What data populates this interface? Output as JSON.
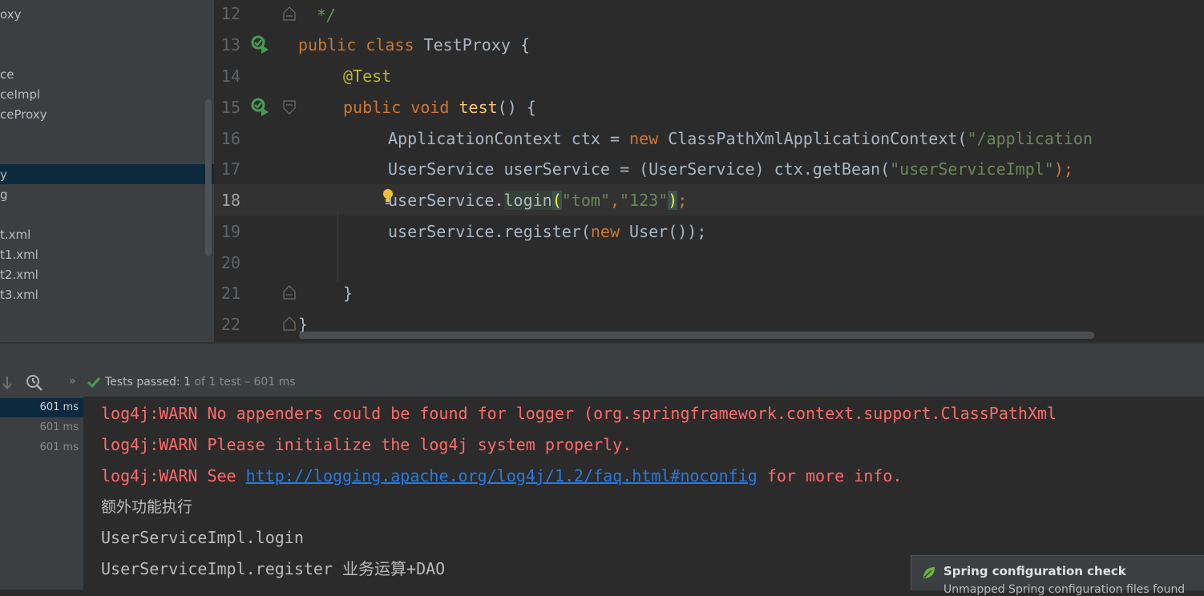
{
  "project_tree": {
    "items": [
      {
        "label": "oxy"
      },
      {
        "label": "ce"
      },
      {
        "label": "ceImpl"
      },
      {
        "label": "ceProxy"
      },
      {
        "label": "y"
      },
      {
        "label": "g"
      },
      {
        "label": "t.xml"
      },
      {
        "label": "t1.xml"
      },
      {
        "label": "t2.xml"
      },
      {
        "label": "t3.xml"
      }
    ]
  },
  "editor": {
    "line_numbers": [
      "12",
      "13",
      "14",
      "15",
      "16",
      "17",
      "18",
      "19",
      "20",
      "21",
      "22"
    ],
    "lines": [
      {
        "l12": " */"
      },
      {
        "l13a": "public class ",
        "l13b": "TestProxy {"
      },
      {
        "l14": "@Test"
      },
      {
        "l15a": "public void ",
        "l15b": "test",
        "l15c": "() {"
      },
      {
        "l16a": "ApplicationContext ctx = ",
        "l16b": "new ",
        "l16c": "ClassPathXmlApplicationContext(",
        "l16d": "\"/application"
      },
      {
        "l17a": "UserService userService = (UserService) ctx.getBean(",
        "l17b": "\"userServiceImpl\"",
        "l17c": ");"
      },
      {
        "l18a": "userService.",
        "l18b": "login",
        "l18c": "(",
        "l18d": "\"tom\"",
        "l18e": ",",
        "l18f": "\"123\"",
        "l18g": ")",
        "l18h": ";"
      },
      {
        "l19a": "userService.register(",
        "l19b": "new ",
        "l19c": "User());"
      },
      {
        "l21": "}"
      },
      {
        "l22": "}"
      }
    ]
  },
  "run_panel": {
    "status_prefix": "Tests passed:",
    "status_count": "1",
    "status_suffix": "of 1 test – 601 ms",
    "durations": [
      "601 ms",
      "601 ms",
      "601 ms"
    ],
    "console": {
      "warn1": "log4j:WARN No appenders could be found for logger (org.springframework.context.support.ClassPathXml",
      "warn2": "log4j:WARN Please initialize the log4j system properly.",
      "warn3_prefix": "log4j:WARN See ",
      "warn3_link": "http://logging.apache.org/log4j/1.2/faq.html#noconfig",
      "warn3_suffix": " for more info.",
      "out1": "额外功能执行",
      "out2": "UserServiceImpl.login",
      "out3": "UserServiceImpl.register 业务运算+DAO"
    }
  },
  "notification": {
    "title": "Spring configuration check",
    "body": "Unmapped Spring configuration files found"
  },
  "colors": {
    "keyword": "#cc7832",
    "string": "#6a8759",
    "annotation": "#bbb529",
    "method": "#ffc66d",
    "warn": "#ff6b68",
    "link": "#287bde",
    "pass": "#499c54"
  }
}
